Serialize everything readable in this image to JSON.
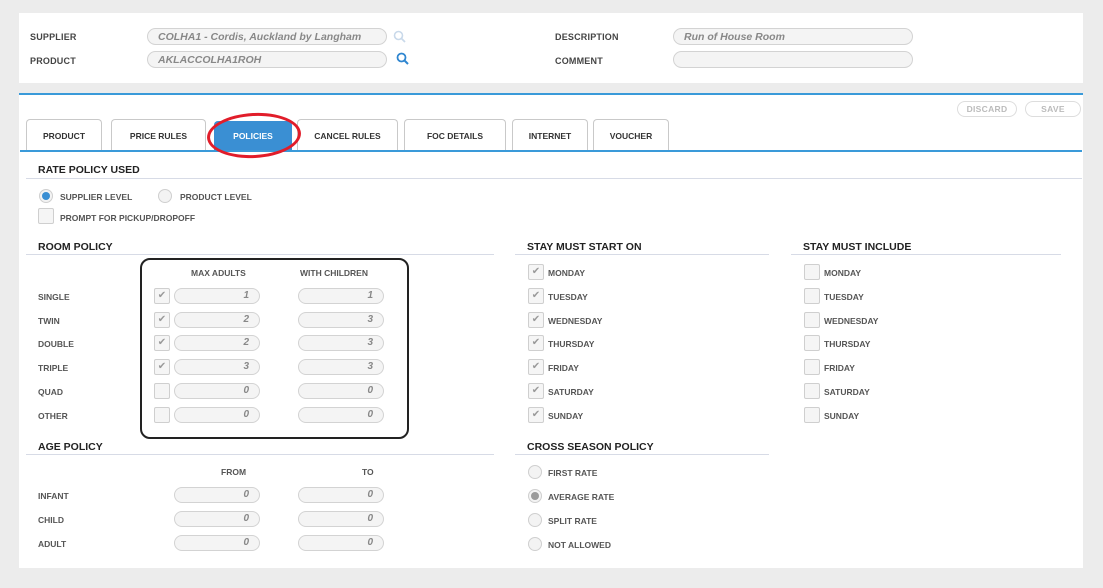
{
  "header": {
    "supplier_label": "SUPPLIER",
    "supplier_value": "COLHA1 - Cordis, Auckland by Langham",
    "product_label": "PRODUCT",
    "product_value": "AKLACCOLHA1ROH",
    "description_label": "DESCRIPTION",
    "description_value": "Run of House Room",
    "comment_label": "COMMENT",
    "comment_value": ""
  },
  "actions": {
    "discard": "DISCARD",
    "save": "SAVE"
  },
  "tabs": [
    {
      "label": "PRODUCT"
    },
    {
      "label": "PRICE RULES"
    },
    {
      "label": "POLICIES",
      "active": true
    },
    {
      "label": "CANCEL RULES"
    },
    {
      "label": "FOC DETAILS"
    },
    {
      "label": "INTERNET"
    },
    {
      "label": "VOUCHER"
    }
  ],
  "rate_policy": {
    "title": "RATE POLICY USED",
    "supplier_level": "SUPPLIER LEVEL",
    "product_level": "PRODUCT LEVEL",
    "selected": "SUPPLIER LEVEL",
    "prompt_pickup": "PROMPT FOR PICKUP/DROPOFF"
  },
  "room_policy": {
    "title": "ROOM POLICY",
    "col_max_adults": "MAX ADULTS",
    "col_with_children": "WITH CHILDREN",
    "rows": [
      {
        "label": "SINGLE",
        "checked": true,
        "max_adults": "1",
        "with_children": "1"
      },
      {
        "label": "TWIN",
        "checked": true,
        "max_adults": "2",
        "with_children": "3"
      },
      {
        "label": "DOUBLE",
        "checked": true,
        "max_adults": "2",
        "with_children": "3"
      },
      {
        "label": "TRIPLE",
        "checked": true,
        "max_adults": "3",
        "with_children": "3"
      },
      {
        "label": "QUAD",
        "checked": false,
        "max_adults": "0",
        "with_children": "0"
      },
      {
        "label": "OTHER",
        "checked": false,
        "max_adults": "0",
        "with_children": "0"
      }
    ]
  },
  "age_policy": {
    "title": "AGE POLICY",
    "col_from": "FROM",
    "col_to": "TO",
    "rows": [
      {
        "label": "INFANT",
        "from": "0",
        "to": "0"
      },
      {
        "label": "CHILD",
        "from": "0",
        "to": "0"
      },
      {
        "label": "ADULT",
        "from": "0",
        "to": "0"
      }
    ]
  },
  "stay_start": {
    "title": "STAY MUST START ON",
    "days": [
      {
        "label": "MONDAY",
        "checked": true
      },
      {
        "label": "TUESDAY",
        "checked": true
      },
      {
        "label": "WEDNESDAY",
        "checked": true
      },
      {
        "label": "THURSDAY",
        "checked": true
      },
      {
        "label": "FRIDAY",
        "checked": true
      },
      {
        "label": "SATURDAY",
        "checked": true
      },
      {
        "label": "SUNDAY",
        "checked": true
      }
    ]
  },
  "stay_include": {
    "title": "STAY MUST INCLUDE",
    "days": [
      {
        "label": "MONDAY",
        "checked": false
      },
      {
        "label": "TUESDAY",
        "checked": false
      },
      {
        "label": "WEDNESDAY",
        "checked": false
      },
      {
        "label": "THURSDAY",
        "checked": false
      },
      {
        "label": "FRIDAY",
        "checked": false
      },
      {
        "label": "SATURDAY",
        "checked": false
      },
      {
        "label": "SUNDAY",
        "checked": false
      }
    ]
  },
  "cross_season": {
    "title": "CROSS SEASON POLICY",
    "options": [
      {
        "label": "FIRST RATE",
        "selected": false
      },
      {
        "label": "AVERAGE RATE",
        "selected": true
      },
      {
        "label": "SPLIT RATE",
        "selected": false
      },
      {
        "label": "NOT ALLOWED",
        "selected": false
      }
    ]
  },
  "colors": {
    "accent": "#3a8fd3",
    "highlight_ring": "#e11d2a"
  },
  "icons": {
    "search": "search-icon",
    "check": "check-icon"
  }
}
